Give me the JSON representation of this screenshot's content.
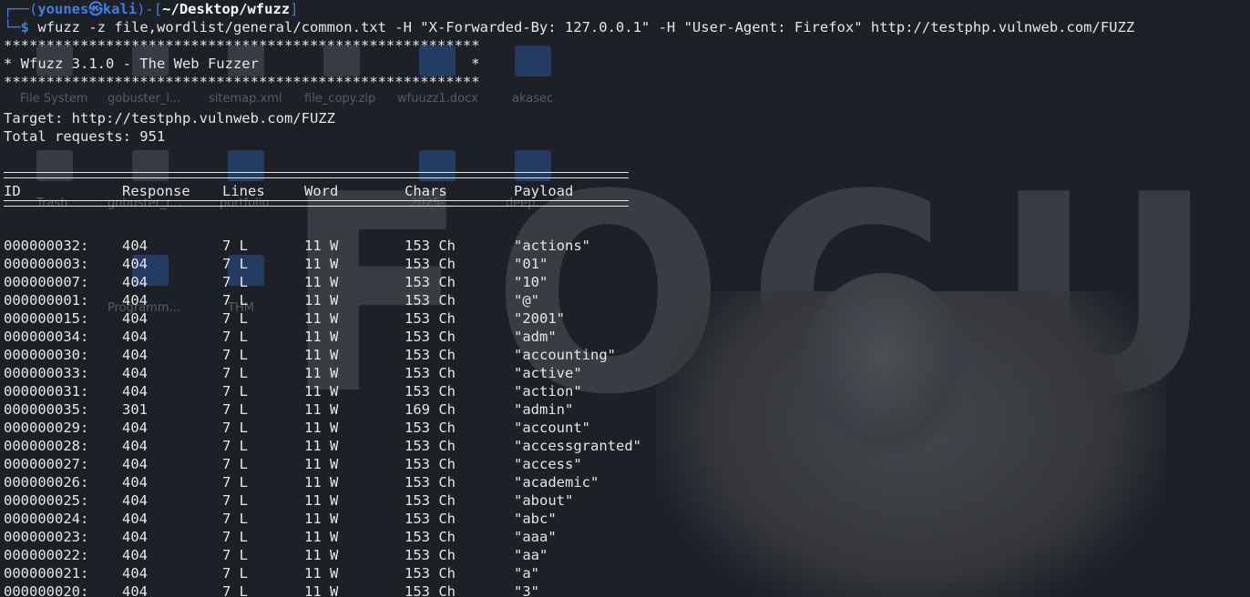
{
  "prompt": {
    "box_top": "┌──(",
    "user": "younes㉿kali",
    "mid": ")-[",
    "cwd": "~/Desktop/wfuzz",
    "close": "]",
    "box_bottom": "└─",
    "dollar": "$",
    "command": "wfuzz -z file,wordlist/general/common.txt -H \"X-Forwarded-By: 127.0.0.1\" -H \"User-Agent: Firefox\" http://testphp.vulnweb.com/FUZZ"
  },
  "banner": {
    "stars": "********************************************************",
    "title": "* Wfuzz 3.1.0 - The Web Fuzzer                         *"
  },
  "target_line": "Target: http://testphp.vulnweb.com/FUZZ",
  "total_line": "Total requests: 951",
  "table": {
    "headers": {
      "id": "ID",
      "response": "Response",
      "lines": "Lines",
      "word": "Word",
      "chars": "Chars",
      "payload": "Payload"
    },
    "rows": [
      {
        "id": "000000032:",
        "response": "404",
        "lines": "7 L",
        "word": "11 W",
        "chars": "153 Ch",
        "payload": "\"actions\""
      },
      {
        "id": "000000003:",
        "response": "404",
        "lines": "7 L",
        "word": "11 W",
        "chars": "153 Ch",
        "payload": "\"01\""
      },
      {
        "id": "000000007:",
        "response": "404",
        "lines": "7 L",
        "word": "11 W",
        "chars": "153 Ch",
        "payload": "\"10\""
      },
      {
        "id": "000000001:",
        "response": "404",
        "lines": "7 L",
        "word": "11 W",
        "chars": "153 Ch",
        "payload": "\"@\""
      },
      {
        "id": "000000015:",
        "response": "404",
        "lines": "7 L",
        "word": "11 W",
        "chars": "153 Ch",
        "payload": "\"2001\""
      },
      {
        "id": "000000034:",
        "response": "404",
        "lines": "7 L",
        "word": "11 W",
        "chars": "153 Ch",
        "payload": "\"adm\""
      },
      {
        "id": "000000030:",
        "response": "404",
        "lines": "7 L",
        "word": "11 W",
        "chars": "153 Ch",
        "payload": "\"accounting\""
      },
      {
        "id": "000000033:",
        "response": "404",
        "lines": "7 L",
        "word": "11 W",
        "chars": "153 Ch",
        "payload": "\"active\""
      },
      {
        "id": "000000031:",
        "response": "404",
        "lines": "7 L",
        "word": "11 W",
        "chars": "153 Ch",
        "payload": "\"action\""
      },
      {
        "id": "000000035:",
        "response": "301",
        "lines": "7 L",
        "word": "11 W",
        "chars": "169 Ch",
        "payload": "\"admin\""
      },
      {
        "id": "000000029:",
        "response": "404",
        "lines": "7 L",
        "word": "11 W",
        "chars": "153 Ch",
        "payload": "\"account\""
      },
      {
        "id": "000000028:",
        "response": "404",
        "lines": "7 L",
        "word": "11 W",
        "chars": "153 Ch",
        "payload": "\"accessgranted\""
      },
      {
        "id": "000000027:",
        "response": "404",
        "lines": "7 L",
        "word": "11 W",
        "chars": "153 Ch",
        "payload": "\"access\""
      },
      {
        "id": "000000026:",
        "response": "404",
        "lines": "7 L",
        "word": "11 W",
        "chars": "153 Ch",
        "payload": "\"academic\""
      },
      {
        "id": "000000025:",
        "response": "404",
        "lines": "7 L",
        "word": "11 W",
        "chars": "153 Ch",
        "payload": "\"about\""
      },
      {
        "id": "000000024:",
        "response": "404",
        "lines": "7 L",
        "word": "11 W",
        "chars": "153 Ch",
        "payload": "\"abc\""
      },
      {
        "id": "000000023:",
        "response": "404",
        "lines": "7 L",
        "word": "11 W",
        "chars": "153 Ch",
        "payload": "\"aaa\""
      },
      {
        "id": "000000022:",
        "response": "404",
        "lines": "7 L",
        "word": "11 W",
        "chars": "153 Ch",
        "payload": "\"aa\""
      },
      {
        "id": "000000021:",
        "response": "404",
        "lines": "7 L",
        "word": "11 W",
        "chars": "153 Ch",
        "payload": "\"a\""
      },
      {
        "id": "000000020:",
        "response": "404",
        "lines": "7 L",
        "word": "11 W",
        "chars": "153 Ch",
        "payload": "\"3\""
      }
    ]
  },
  "desktop": {
    "icon_labels": [
      "File System",
      "gobuster_l...",
      "sitemap.xml",
      "file_copy.zip",
      "wfuuzz1.docx",
      "akasec",
      "Trash",
      "gobuster_r...",
      "portfolio",
      "2025-...",
      "deep...",
      "Programm...",
      "THM"
    ],
    "wallpaper_letters": [
      "F",
      "O",
      "C",
      "U"
    ]
  },
  "colors": {
    "background": "#1d2027",
    "prompt_blue": "#3f7fe0",
    "text": "#e6e6e6",
    "wallpaper_text": "#3a3c43"
  }
}
